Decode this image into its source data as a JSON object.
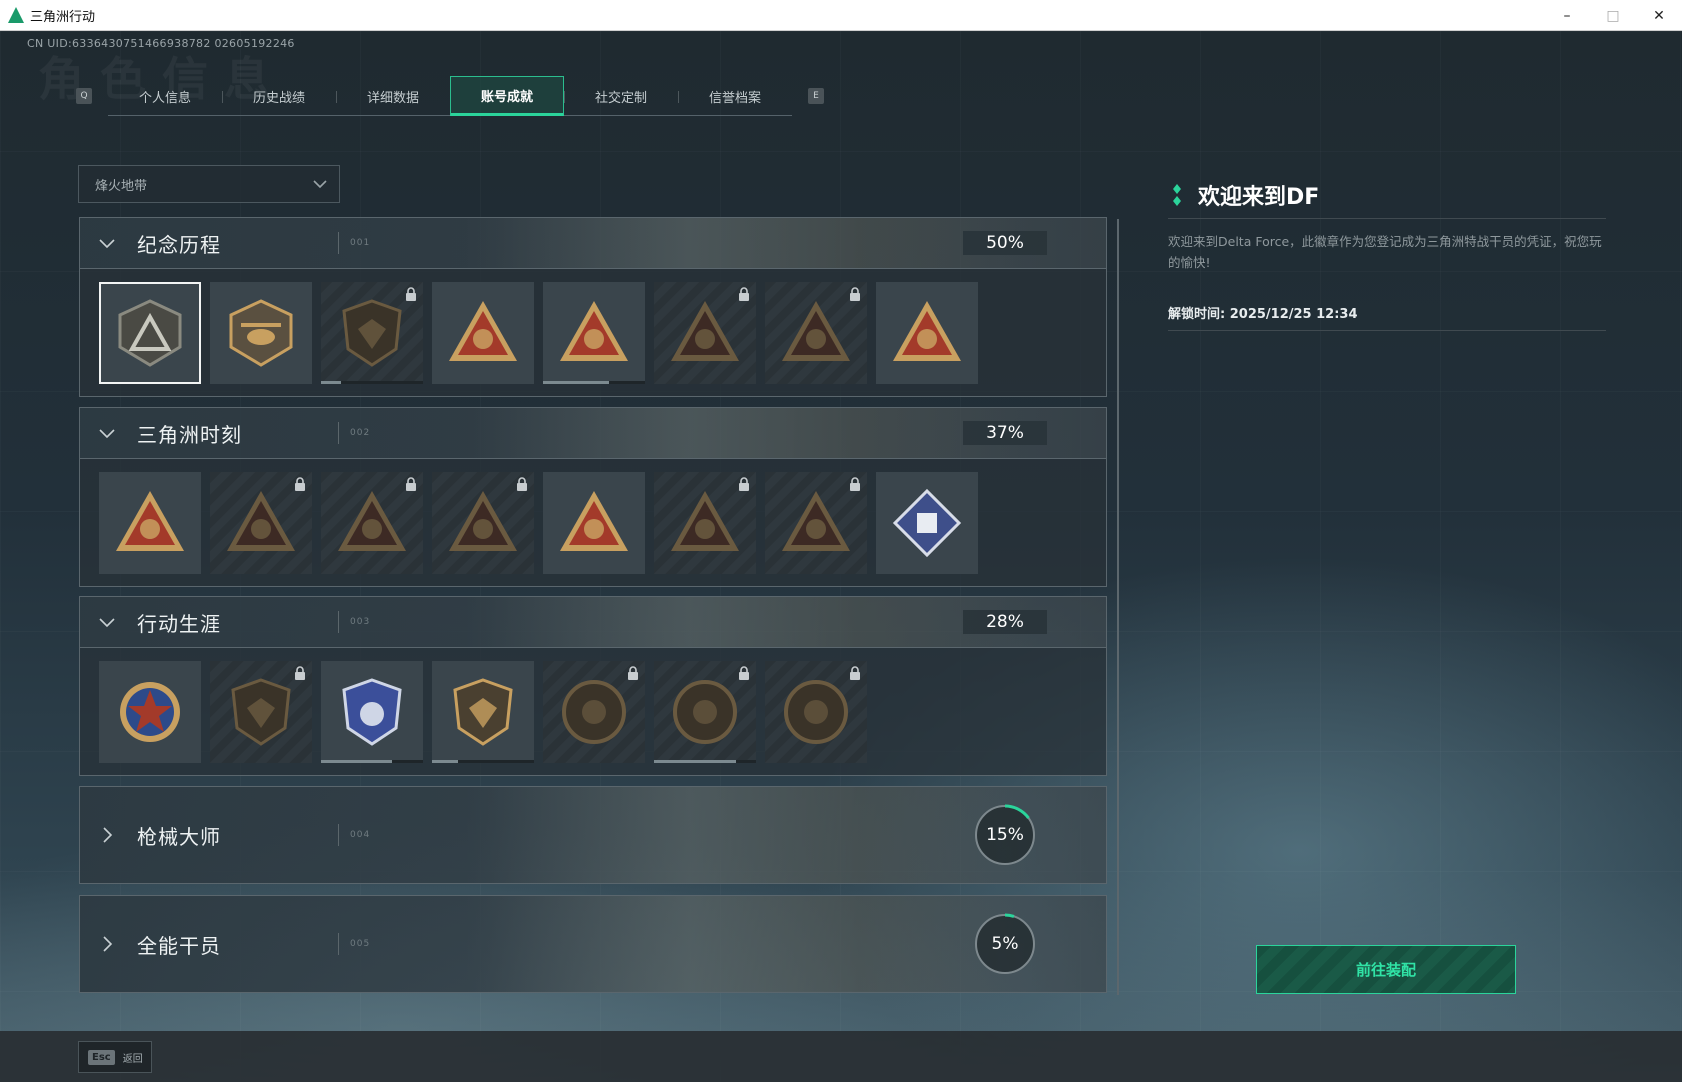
{
  "window": {
    "title": "三角洲行动",
    "minimize": "–",
    "maximize": "□",
    "close": "✕"
  },
  "uid": "CN UID:6336430751466938782 02605192246",
  "background_title": "角色信息",
  "tabs": {
    "prev_key": "Q",
    "next_key": "E",
    "items": [
      {
        "label": "个人信息",
        "active": false
      },
      {
        "label": "历史战绩",
        "active": false
      },
      {
        "label": "详细数据",
        "active": false
      },
      {
        "label": "账号成就",
        "active": true
      },
      {
        "label": "社交定制",
        "active": false
      },
      {
        "label": "信誉档案",
        "active": false
      }
    ]
  },
  "mode_dropdown": {
    "value": "烽火地带"
  },
  "categories": [
    {
      "title": "纪念历程",
      "code": "001",
      "progress": "50%",
      "expanded": true,
      "badges": [
        {
          "icon": "delta-emblem-badge-icon",
          "locked": false,
          "selected": true
        },
        {
          "icon": "helicopter-badge-icon",
          "locked": false
        },
        {
          "icon": "shield-badge-icon",
          "locked": true,
          "progress": 0.2
        },
        {
          "icon": "s8-triangle-badge-icon",
          "locked": false
        },
        {
          "icon": "s9-triangle-badge-icon",
          "locked": false,
          "progress": 0.65
        },
        {
          "icon": "helmet-triangle-badge-icon",
          "locked": true
        },
        {
          "icon": "soldier-triangle-badge-icon",
          "locked": true
        },
        {
          "icon": "bird-triangle-badge-icon",
          "locked": false
        }
      ]
    },
    {
      "title": "三角洲时刻",
      "code": "002",
      "progress": "37%",
      "expanded": true,
      "badges": [
        {
          "icon": "cargo-triangle-badge-icon",
          "locked": false
        },
        {
          "icon": "vehicle-triangle-badge-icon",
          "locked": true
        },
        {
          "icon": "runner-triangle-badge-icon",
          "locked": true
        },
        {
          "icon": "hands-triangle-badge-icon",
          "locked": true
        },
        {
          "icon": "squad-triangle-badge-icon",
          "locked": false
        },
        {
          "icon": "group-triangle-badge-icon",
          "locked": true
        },
        {
          "icon": "dragon-triangle-badge-icon",
          "locked": true
        },
        {
          "icon": "diamond-fist-badge-icon",
          "locked": false
        }
      ]
    },
    {
      "title": "行动生涯",
      "code": "003",
      "progress": "28%",
      "expanded": true,
      "badges": [
        {
          "icon": "star-medal-badge-icon",
          "locked": false
        },
        {
          "icon": "chevron-shield-badge-icon",
          "locked": true
        },
        {
          "icon": "police-shield-badge-icon",
          "locked": false,
          "progress": 0.7
        },
        {
          "icon": "gem-shield-badge-icon",
          "locked": false,
          "progress": 0.25
        },
        {
          "icon": "shell-round-badge-icon",
          "locked": true
        },
        {
          "icon": "skull-round-badge-icon",
          "locked": true,
          "progress": 0.8
        },
        {
          "icon": "eye-round-badge-icon",
          "locked": true
        }
      ]
    },
    {
      "title": "枪械大师",
      "code": "004",
      "progress": "15%",
      "progress_value": 0.15,
      "expanded": false
    },
    {
      "title": "全能干员",
      "code": "005",
      "progress": "5%",
      "progress_value": 0.05,
      "expanded": false
    }
  ],
  "details": {
    "title": "欢迎来到DF",
    "description": "欢迎来到Delta Force，此徽章作为您登记成为三角洲特战干员的凭证，祝您玩的愉快!",
    "unlock_time": "解锁时间: 2025/12/25 12:34",
    "equip_button": "前往装配"
  },
  "bottom": {
    "esc_key": "Esc",
    "back_label": "返回"
  },
  "colors": {
    "accent": "#2bd49b",
    "badge_gold": "#c8a060",
    "badge_red": "#a33a2a"
  }
}
